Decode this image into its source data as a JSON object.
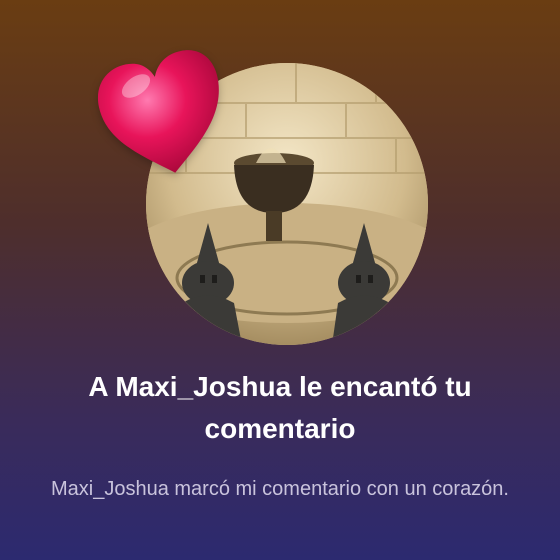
{
  "notification": {
    "avatar_icon": "profile-picture",
    "reaction_icon": "heart-icon",
    "title": "A Maxi_Joshua le encantó tu comentario",
    "message": "Maxi_Joshua marcó mi comentario con un corazón."
  },
  "colors": {
    "background_top": "#6a3d12",
    "background_bottom": "#2c2a70",
    "heart": "#e8145a",
    "title_text": "#ffffff",
    "message_text": "#c9c3dc"
  }
}
